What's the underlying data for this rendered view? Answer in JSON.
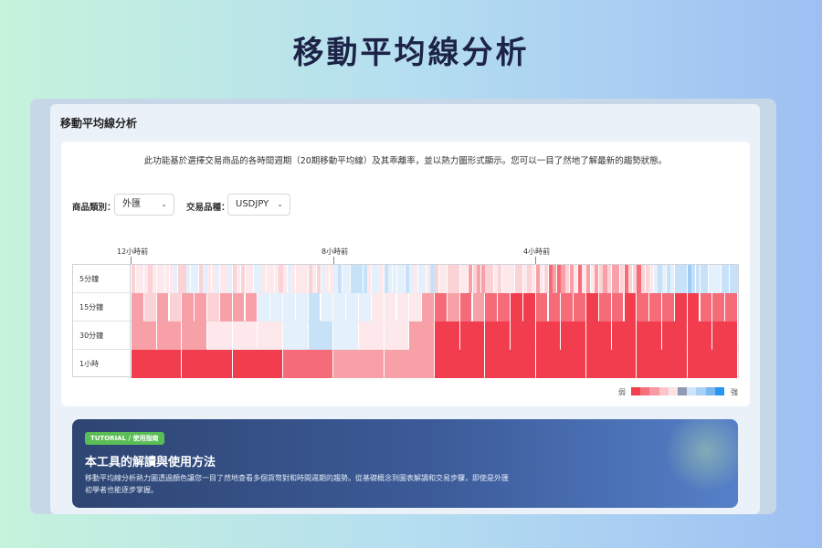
{
  "hero": {
    "title": "移動平均線分析"
  },
  "panel": {
    "title": "移動平均線分析",
    "description": "此功能基於選擇交易商品的各時間週期（20期移動平均線）及其乖離率，並以熱力圖形式顯示。您可以一目了然地了解最新的趨勢狀態。"
  },
  "filters": {
    "category_label": "商品類別：",
    "category_value": "外匯",
    "instrument_label": "交易品種：",
    "instrument_value": "USDJPY"
  },
  "heatmap": {
    "time_markers": [
      "12小時前",
      "8小時前",
      "4小時前"
    ],
    "rows": [
      {
        "label": "5分鐘",
        "cells": 144
      },
      {
        "label": "15分鐘",
        "cells": 48
      },
      {
        "label": "30分鐘",
        "cells": 24
      },
      {
        "label": "1小時",
        "cells": 12
      }
    ],
    "legend": {
      "weak_label": "弱",
      "strong_label": "強",
      "colors": [
        "#f2404e",
        "#f5707a",
        "#f79aa1",
        "#fac4c8",
        "#fbe2e4",
        "#8e9bb5",
        "#cfe4f7",
        "#a9d1f5",
        "#78b8f2",
        "#2a96ee"
      ]
    },
    "colors": {
      "strong_red": "#f23d4f",
      "red": "#f56b78",
      "pink": "#f8a0a8",
      "light_pink": "#fbd3d7",
      "pale_pink": "#fde9eb",
      "pale_blue": "#e4f0fb",
      "light_blue": "#c7e1f8",
      "blue": "#9dccf5"
    }
  },
  "tutorial": {
    "badge": "TUTORIAL / 使用指南",
    "heading": "本工具的解讀與使用方法",
    "text": "移動平均線分析熱力圖透過顏色讓您一目了然地查看多個貨幣對和時間週期的趨勢。從基礎概念到圖表解讀和交易步驟，即使是外匯初學者也能逐步掌握。"
  }
}
